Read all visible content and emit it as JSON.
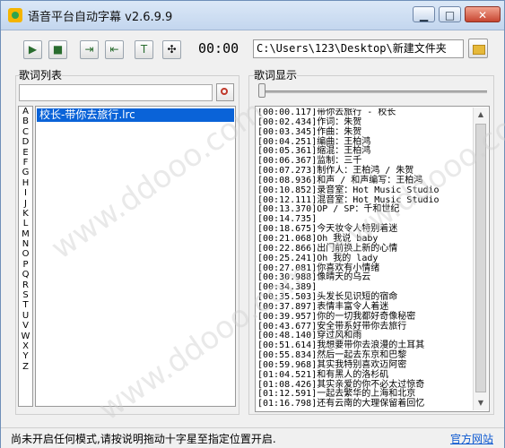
{
  "window": {
    "title": "语音平台自动字幕 v2.6.9.9",
    "minimize": "▁",
    "maximize": "□",
    "close": "✕"
  },
  "toolbar": {
    "buttons": [
      {
        "name": "play",
        "icon": "▶"
      },
      {
        "name": "stop",
        "icon": "■"
      },
      {
        "name": "import",
        "icon": "⇥"
      },
      {
        "name": "export",
        "icon": "⇤"
      },
      {
        "name": "text",
        "icon": "T"
      },
      {
        "name": "move",
        "icon": "✣"
      }
    ],
    "time": "00:00",
    "path": "C:\\Users\\123\\Desktop\\新建文件夹"
  },
  "left": {
    "title": "歌词列表",
    "search_value": "",
    "letters": [
      "A",
      "B",
      "C",
      "D",
      "E",
      "F",
      "G",
      "H",
      "I",
      "J",
      "K",
      "L",
      "M",
      "N",
      "O",
      "P",
      "Q",
      "R",
      "S",
      "T",
      "U",
      "V",
      "W",
      "X",
      "Y",
      "Z"
    ],
    "files": [
      "校长-带你去旅行.lrc"
    ]
  },
  "right": {
    "title": "歌词显示",
    "lines": [
      "[00:00.117]带你去旅行 - 校长",
      "[00:02.434]作词：朱贺",
      "[00:03.345]作曲：朱贺",
      "[00:04.251]编曲：王柏鸿",
      "[00:05.361]缩混：王柏鸿",
      "[00:06.367]监制：三千",
      "[00:07.273]制作人：王柏鸿 / 朱贺",
      "[00:08.936]和声 / 和声编写：王柏鸿",
      "[00:10.852]录音室：Hot Music Studio",
      "[00:12.111]混音室：Hot Music Studio",
      "[00:13.370]OP / SP：千和世纪",
      "[00:14.735]",
      "[00:18.675]今天妆令人特别着迷",
      "[00:21.068]Oh 我说 baby",
      "[00:22.866]出门前换上新的心情",
      "[00:25.241]Oh 我的 lady",
      "[00:27.081]你喜欢有小情绪",
      "[00:30.988]像晴天的乌云",
      "[00:34.389]",
      "[00:35.503]头发长见识短的宿命",
      "[00:37.897]表情丰富令人着迷",
      "[00:39.957]你的一切我都好奇像秘密",
      "[00:43.677]安全带系好带你去旅行",
      "[00:48.140]穿过风和雨",
      "[00:51.614]我想要带你去浪漫的土耳其",
      "[00:55.834]然后一起去东京和巴黎",
      "[00:59.968]其实我特别喜欢迈阿密",
      "[01:04.521]和有黑人的洛杉矶",
      "[01:08.426]其实亲爱的你不必太过惊奇",
      "[01:12.591]一起去繁华的上海和北京",
      "[01:16.798]还有云南的大理保留着回忆"
    ]
  },
  "status": {
    "text": "尚未开启任何模式,请按说明拖动十字星至指定位置开启.",
    "link": "官方网站"
  },
  "watermark": {
    "text": "www.ddooo.com"
  }
}
